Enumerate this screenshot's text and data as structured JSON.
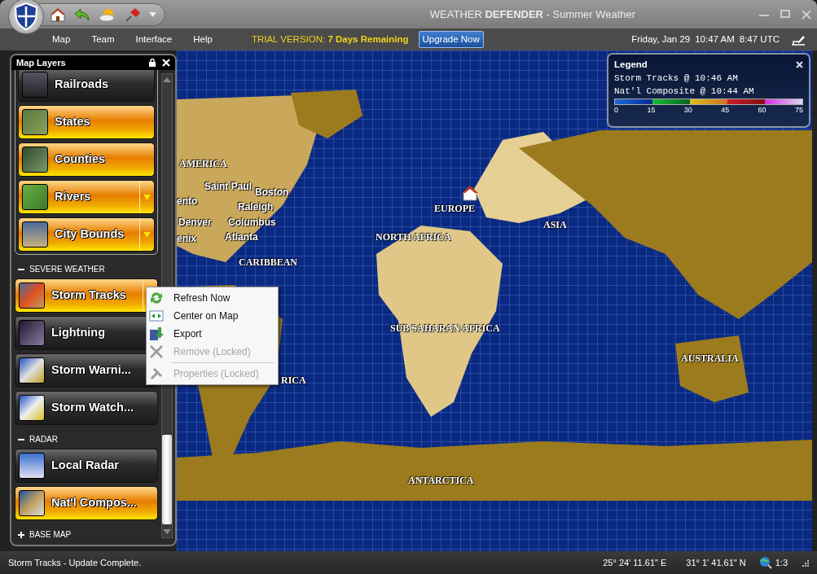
{
  "window": {
    "title": "WEATHER **DEFENDER**  - Summer Weather"
  },
  "menu": [
    "Map",
    "Team",
    "Interface",
    "Help"
  ],
  "trial": "TRIAL VERSION: **7 Days Remaining**",
  "upgrade_button": "Upgrade Now",
  "clock": {
    "date": "Friday, Jan 29",
    "local_time": "10:47 AM",
    "utc_time": "8:47 UTC"
  },
  "layers_panel": {
    "title": "Map Layers",
    "groups": [
      {
        "expanded": true,
        "items": [
          {
            "label": "Railroads",
            "on": false,
            "dropdown": false
          },
          {
            "label": "States",
            "on": true,
            "dropdown": false
          },
          {
            "label": "Counties",
            "on": true,
            "dropdown": false
          },
          {
            "label": "Rivers",
            "on": true,
            "dropdown": true
          },
          {
            "label": "City Bounds",
            "on": true,
            "dropdown": true
          }
        ]
      },
      {
        "heading": "SEVERE WEATHER",
        "expanded": true,
        "items": [
          {
            "label": "Storm Tracks",
            "on": true,
            "dropdown": true
          },
          {
            "label": "Lightning",
            "on": false,
            "dropdown": false
          },
          {
            "label": "Storm  Warni...",
            "on": false,
            "dropdown": false
          },
          {
            "label": "Storm  Watch...",
            "on": false,
            "dropdown": false
          }
        ]
      },
      {
        "heading": "RADAR",
        "expanded": true,
        "items": [
          {
            "label": "Local Radar",
            "on": false,
            "dropdown": false
          },
          {
            "label": "Nat'l Compos...",
            "on": true,
            "dropdown": false
          }
        ]
      },
      {
        "heading": "BASE MAP",
        "expanded": false
      }
    ]
  },
  "context_menu": [
    {
      "label": "Refresh Now",
      "kind": "refresh",
      "disabled": false
    },
    {
      "label": "Center on Map",
      "kind": "center",
      "disabled": false
    },
    {
      "label": "Export",
      "kind": "export",
      "disabled": false
    },
    {
      "label": "Remove (Locked)",
      "kind": "remove",
      "disabled": true
    },
    {
      "label": "Properties (Locked)",
      "kind": "properties",
      "disabled": true
    }
  ],
  "legend": {
    "title": "Legend",
    "lines": [
      "Storm Tracks @ 10:46 AM",
      "Nat'l Composite @ 10:44 AM"
    ],
    "scale_ticks": [
      "0",
      "15",
      "30",
      "45",
      "60",
      "75"
    ]
  },
  "map_labels": [
    {
      "text": "AMERICA",
      "kind": "region"
    },
    {
      "text": "Saint Paul",
      "kind": "city"
    },
    {
      "text": "Boston",
      "kind": "city"
    },
    {
      "text": "ento",
      "kind": "city"
    },
    {
      "text": "Raleigh",
      "kind": "city"
    },
    {
      "text": "Denver",
      "kind": "city"
    },
    {
      "text": "Columbus",
      "kind": "city"
    },
    {
      "text": "enix",
      "kind": "city"
    },
    {
      "text": "Atlanta",
      "kind": "city"
    },
    {
      "text": "CARIBBEAN",
      "kind": "region"
    },
    {
      "text": "EUROPE",
      "kind": "region"
    },
    {
      "text": "ASIA",
      "kind": "region"
    },
    {
      "text": "NORTH AFRICA",
      "kind": "region"
    },
    {
      "text": "SUB SAHARAN AFRICA",
      "kind": "region"
    },
    {
      "text": "RICA",
      "kind": "region"
    },
    {
      "text": "AUSTRALIA",
      "kind": "region"
    },
    {
      "text": "ANTARCTICA",
      "kind": "region"
    }
  ],
  "status_bar": {
    "message": "Storm Tracks - Update Complete.",
    "longitude": "25° 24' 11.61\" E",
    "latitude": "31° 1' 41.61\" N",
    "zoom": "1:3"
  }
}
